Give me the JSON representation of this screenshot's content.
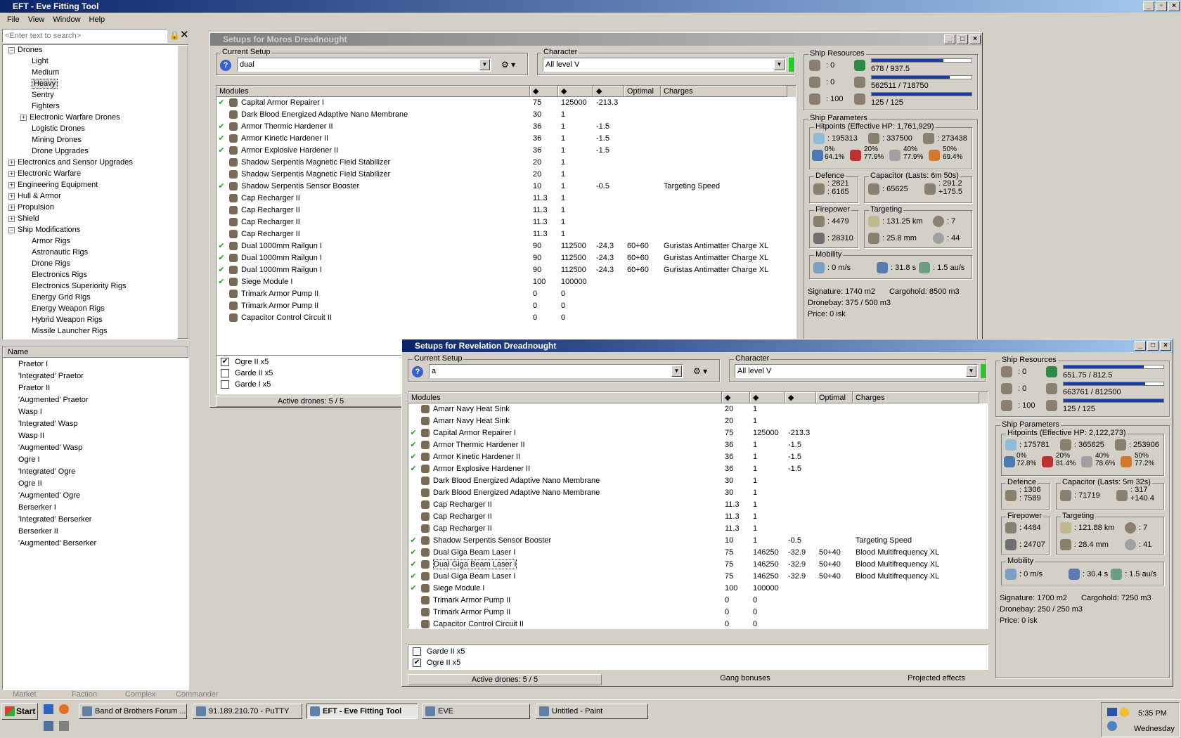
{
  "app": {
    "title": "EFT - Eve Fitting Tool",
    "menu": [
      "File",
      "View",
      "Window",
      "Help"
    ]
  },
  "search": {
    "placeholder": "<Enter text to search>"
  },
  "tree": [
    {
      "label": "Drones",
      "level": 0,
      "exp": "−"
    },
    {
      "label": "Light",
      "level": 1
    },
    {
      "label": "Medium",
      "level": 1
    },
    {
      "label": "Heavy",
      "level": 1,
      "selected": true
    },
    {
      "label": "Sentry",
      "level": 1
    },
    {
      "label": "Fighters",
      "level": 1
    },
    {
      "label": "Electronic Warfare Drones",
      "level": 1,
      "exp": "+"
    },
    {
      "label": "Logistic Drones",
      "level": 1
    },
    {
      "label": "Mining Drones",
      "level": 1
    },
    {
      "label": "Drone Upgrades",
      "level": 1
    },
    {
      "label": "Electronics and Sensor Upgrades",
      "level": 0,
      "exp": "+"
    },
    {
      "label": "Electronic Warfare",
      "level": 0,
      "exp": "+"
    },
    {
      "label": "Engineering Equipment",
      "level": 0,
      "exp": "+"
    },
    {
      "label": "Hull & Armor",
      "level": 0,
      "exp": "+"
    },
    {
      "label": "Propulsion",
      "level": 0,
      "exp": "+"
    },
    {
      "label": "Shield",
      "level": 0,
      "exp": "+"
    },
    {
      "label": "Ship Modifications",
      "level": 0,
      "exp": "−"
    },
    {
      "label": "Armor Rigs",
      "level": 1
    },
    {
      "label": "Astronautic Rigs",
      "level": 1
    },
    {
      "label": "Drone Rigs",
      "level": 1
    },
    {
      "label": "Electronics Rigs",
      "level": 1
    },
    {
      "label": "Electronics Superiority Rigs",
      "level": 1
    },
    {
      "label": "Energy Grid Rigs",
      "level": 1
    },
    {
      "label": "Energy Weapon Rigs",
      "level": 1
    },
    {
      "label": "Hybrid Weapon Rigs",
      "level": 1
    },
    {
      "label": "Missile Launcher Rigs",
      "level": 1
    }
  ],
  "itemlist": {
    "header": "Name",
    "items": [
      "Praetor I",
      "'Integrated' Praetor",
      "Praetor II",
      "'Augmented' Praetor",
      "Wasp I",
      "'Integrated' Wasp",
      "Wasp II",
      "'Augmented' Wasp",
      "Ogre I",
      "'Integrated' Ogre",
      "Ogre II",
      "'Augmented' Ogre",
      "Berserker I",
      "'Integrated' Berserker",
      "Berserker II",
      "'Augmented' Berserker"
    ]
  },
  "bottom_tabs": [
    "Market",
    "Faction",
    "Complex",
    "Commander"
  ],
  "moros": {
    "title": "Setups for Moros Dreadnought",
    "setup_label": "Current Setup",
    "setup": "dual",
    "char_label": "Character",
    "character": "All level V",
    "cols": [
      "Modules",
      "",
      "",
      "",
      "Optimal",
      "Charges"
    ],
    "modules": [
      {
        "c": true,
        "n": "Capital Armor Repairer I",
        "a": "75",
        "b": "125000",
        "d": "-213.3",
        "o": "",
        "ch": ""
      },
      {
        "c": false,
        "n": "Dark Blood Energized Adaptive Nano Membrane",
        "a": "30",
        "b": "1",
        "d": "",
        "o": "",
        "ch": ""
      },
      {
        "c": true,
        "n": "Armor Thermic Hardener II",
        "a": "36",
        "b": "1",
        "d": "-1.5",
        "o": "",
        "ch": ""
      },
      {
        "c": true,
        "n": "Armor Kinetic Hardener II",
        "a": "36",
        "b": "1",
        "d": "-1.5",
        "o": "",
        "ch": ""
      },
      {
        "c": true,
        "n": "Armor Explosive Hardener II",
        "a": "36",
        "b": "1",
        "d": "-1.5",
        "o": "",
        "ch": ""
      },
      {
        "c": false,
        "n": "Shadow Serpentis Magnetic Field Stabilizer",
        "a": "20",
        "b": "1",
        "d": "",
        "o": "",
        "ch": ""
      },
      {
        "c": false,
        "n": "Shadow Serpentis Magnetic Field Stabilizer",
        "a": "20",
        "b": "1",
        "d": "",
        "o": "",
        "ch": ""
      },
      {
        "c": true,
        "n": "Shadow Serpentis Sensor Booster",
        "a": "10",
        "b": "1",
        "d": "-0.5",
        "o": "",
        "ch": "Targeting Speed"
      },
      {
        "c": false,
        "n": "Cap Recharger II",
        "a": "11.3",
        "b": "1",
        "d": "",
        "o": "",
        "ch": ""
      },
      {
        "c": false,
        "n": "Cap Recharger II",
        "a": "11.3",
        "b": "1",
        "d": "",
        "o": "",
        "ch": ""
      },
      {
        "c": false,
        "n": "Cap Recharger II",
        "a": "11.3",
        "b": "1",
        "d": "",
        "o": "",
        "ch": ""
      },
      {
        "c": false,
        "n": "Cap Recharger II",
        "a": "11.3",
        "b": "1",
        "d": "",
        "o": "",
        "ch": ""
      },
      {
        "c": true,
        "n": "Dual 1000mm Railgun I",
        "a": "90",
        "b": "112500",
        "d": "-24.3",
        "o": "60+60",
        "ch": "Guristas Antimatter Charge XL"
      },
      {
        "c": true,
        "n": "Dual 1000mm Railgun I",
        "a": "90",
        "b": "112500",
        "d": "-24.3",
        "o": "60+60",
        "ch": "Guristas Antimatter Charge XL"
      },
      {
        "c": true,
        "n": "Dual 1000mm Railgun I",
        "a": "90",
        "b": "112500",
        "d": "-24.3",
        "o": "60+60",
        "ch": "Guristas Antimatter Charge XL"
      },
      {
        "c": true,
        "n": "Siege Module I",
        "a": "100",
        "b": "100000",
        "d": "",
        "o": "",
        "ch": ""
      },
      {
        "c": false,
        "n": "Trimark Armor Pump II",
        "a": "0",
        "b": "0",
        "d": "",
        "o": "",
        "ch": ""
      },
      {
        "c": false,
        "n": "Trimark Armor Pump II",
        "a": "0",
        "b": "0",
        "d": "",
        "o": "",
        "ch": ""
      },
      {
        "c": false,
        "n": "Capacitor Control Circuit II",
        "a": "0",
        "b": "0",
        "d": "",
        "o": "",
        "ch": ""
      }
    ],
    "drones": [
      {
        "checked": true,
        "label": "Ogre II x5"
      },
      {
        "checked": false,
        "label": "Garde II x5"
      },
      {
        "checked": false,
        "label": "Garde I x5"
      }
    ],
    "active_drones": "Active drones: 5 / 5",
    "res": {
      "label": "Ship Resources",
      "turret": "0",
      "launcher": "0",
      "calib": "100",
      "cpu": "678 / 937.5",
      "cpu_frac": 0.72,
      "pg": "562511 / 718750",
      "pg_frac": 0.78,
      "cal": "125 / 125",
      "cal_frac": 1.0
    },
    "params": {
      "label": "Ship Parameters",
      "hp_label": "Hitpoints (Effective HP: 1,761,929)",
      "shield": "195313",
      "armor": "337500",
      "hull": "273438",
      "r1a": "0%",
      "r1b": "64.1%",
      "r2a": "20%",
      "r2b": "77.9%",
      "r3a": "40%",
      "r3b": "77.9%",
      "r4a": "50%",
      "r4b": "69.4%",
      "def_label": "Defence",
      "def1": "2821",
      "def2": "6165",
      "cap_label": "Capacitor (Lasts: 6m 50s)",
      "cap1": "65625",
      "cap2": "291.2",
      "cap3": "+175.5",
      "fp_label": "Firepower",
      "fp1": "4479",
      "fp2": "28310",
      "tg_label": "Targeting",
      "tg1": "131.25 km",
      "tg2": "7",
      "tg3": "25.8 mm",
      "tg4": "44",
      "mob_label": "Mobility",
      "mob1": "0 m/s",
      "mob2": "31.8 s",
      "mob3": "1.5 au/s",
      "sig": "Signature: 1740 m2",
      "cargo": "Cargohold: 8500 m3",
      "dronebay": "Dronebay: 375 / 500 m3",
      "price": "Price: 0 isk"
    }
  },
  "rev": {
    "title": "Setups for Revelation Dreadnought",
    "setup_label": "Current Setup",
    "setup": "a",
    "char_label": "Character",
    "character": "All level V",
    "cols": [
      "Modules",
      "",
      "",
      "",
      "Optimal",
      "Charges"
    ],
    "modules": [
      {
        "c": false,
        "n": "Amarr Navy Heat Sink",
        "a": "20",
        "b": "1",
        "d": "",
        "o": "",
        "ch": ""
      },
      {
        "c": false,
        "n": "Amarr Navy Heat Sink",
        "a": "20",
        "b": "1",
        "d": "",
        "o": "",
        "ch": ""
      },
      {
        "c": true,
        "n": "Capital Armor Repairer I",
        "a": "75",
        "b": "125000",
        "d": "-213.3",
        "o": "",
        "ch": ""
      },
      {
        "c": true,
        "n": "Armor Thermic Hardener II",
        "a": "36",
        "b": "1",
        "d": "-1.5",
        "o": "",
        "ch": ""
      },
      {
        "c": true,
        "n": "Armor Kinetic Hardener II",
        "a": "36",
        "b": "1",
        "d": "-1.5",
        "o": "",
        "ch": ""
      },
      {
        "c": true,
        "n": "Armor Explosive Hardener II",
        "a": "36",
        "b": "1",
        "d": "-1.5",
        "o": "",
        "ch": ""
      },
      {
        "c": false,
        "n": "Dark Blood Energized Adaptive Nano Membrane",
        "a": "30",
        "b": "1",
        "d": "",
        "o": "",
        "ch": ""
      },
      {
        "c": false,
        "n": "Dark Blood Energized Adaptive Nano Membrane",
        "a": "30",
        "b": "1",
        "d": "",
        "o": "",
        "ch": ""
      },
      {
        "c": false,
        "n": "Cap Recharger II",
        "a": "11.3",
        "b": "1",
        "d": "",
        "o": "",
        "ch": ""
      },
      {
        "c": false,
        "n": "Cap Recharger II",
        "a": "11.3",
        "b": "1",
        "d": "",
        "o": "",
        "ch": ""
      },
      {
        "c": false,
        "n": "Cap Recharger II",
        "a": "11.3",
        "b": "1",
        "d": "",
        "o": "",
        "ch": ""
      },
      {
        "c": true,
        "n": "Shadow Serpentis Sensor Booster",
        "a": "10",
        "b": "1",
        "d": "-0.5",
        "o": "",
        "ch": "Targeting Speed"
      },
      {
        "c": true,
        "n": "Dual Giga Beam Laser I",
        "a": "75",
        "b": "146250",
        "d": "-32.9",
        "o": "50+40",
        "ch": "Blood Multifrequency XL"
      },
      {
        "c": true,
        "n": "Dual Giga Beam Laser I",
        "a": "75",
        "b": "146250",
        "d": "-32.9",
        "o": "50+40",
        "ch": "Blood Multifrequency XL",
        "focus": true
      },
      {
        "c": true,
        "n": "Dual Giga Beam Laser I",
        "a": "75",
        "b": "146250",
        "d": "-32.9",
        "o": "50+40",
        "ch": "Blood Multifrequency XL"
      },
      {
        "c": true,
        "n": "Siege Module I",
        "a": "100",
        "b": "100000",
        "d": "",
        "o": "",
        "ch": ""
      },
      {
        "c": false,
        "n": "Trimark Armor Pump II",
        "a": "0",
        "b": "0",
        "d": "",
        "o": "",
        "ch": ""
      },
      {
        "c": false,
        "n": "Trimark Armor Pump II",
        "a": "0",
        "b": "0",
        "d": "",
        "o": "",
        "ch": ""
      },
      {
        "c": false,
        "n": "Capacitor Control Circuit II",
        "a": "0",
        "b": "0",
        "d": "",
        "o": "",
        "ch": ""
      }
    ],
    "drones": [
      {
        "checked": false,
        "label": "Garde II x5"
      },
      {
        "checked": true,
        "label": "Ogre II x5"
      }
    ],
    "active_drones": "Active drones: 5 / 5",
    "gang": "Gang bonuses",
    "projected": "Projected effects",
    "res": {
      "label": "Ship Resources",
      "turret": "0",
      "launcher": "0",
      "calib": "100",
      "cpu": "651.75 / 812.5",
      "cpu_frac": 0.8,
      "pg": "663761 / 812500",
      "pg_frac": 0.82,
      "cal": "125 / 125",
      "cal_frac": 1.0
    },
    "params": {
      "label": "Ship Parameters",
      "hp_label": "Hitpoints (Effective HP: 2,122,273)",
      "shield": "175781",
      "armor": "365625",
      "hull": "253906",
      "r1a": "0%",
      "r1b": "72.8%",
      "r2a": "20%",
      "r2b": "81.4%",
      "r3a": "40%",
      "r3b": "78.6%",
      "r4a": "50%",
      "r4b": "77.2%",
      "def_label": "Defence",
      "def1": "1306",
      "def2": "7589",
      "cap_label": "Capacitor (Lasts: 5m 32s)",
      "cap1": "71719",
      "cap2": "317",
      "cap3": "+140.4",
      "fp_label": "Firepower",
      "fp1": "4484",
      "fp2": "24707",
      "tg_label": "Targeting",
      "tg1": "121.88 km",
      "tg2": "7",
      "tg3": "28.4 mm",
      "tg4": "41",
      "mob_label": "Mobility",
      "mob1": "0 m/s",
      "mob2": "30.4 s",
      "mob3": "1.5 au/s",
      "sig": "Signature: 1700 m2",
      "cargo": "Cargohold: 7250 m3",
      "dronebay": "Dronebay: 250 / 250 m3",
      "price": "Price: 0 isk"
    }
  },
  "taskbar": {
    "start": "Start",
    "buttons": [
      "Band of Brothers Forum ...",
      "91.189.210.70 - PuTTY",
      "EFT - Eve Fitting Tool",
      "EVE",
      "Untitled - Paint"
    ],
    "time": "5:35 PM",
    "day": "Wednesday"
  }
}
